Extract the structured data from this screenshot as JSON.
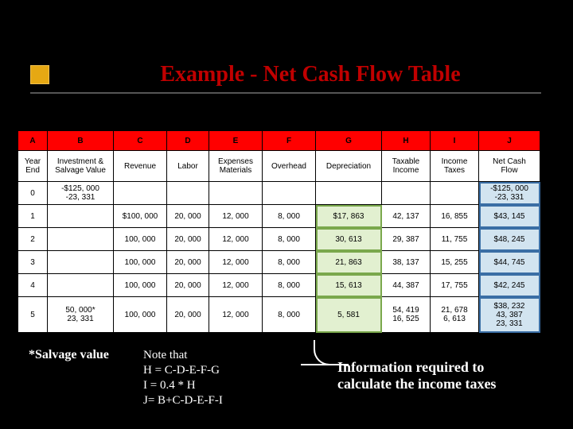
{
  "title": "Example - Net Cash Flow Table",
  "cols": {
    "A": "A",
    "B": "B",
    "C": "C",
    "D": "D",
    "E": "E",
    "F": "F",
    "G": "G",
    "H": "H",
    "I": "I",
    "J": "J"
  },
  "hdr": {
    "A": "Year\nEnd",
    "B": "Investment &\nSalvage Value",
    "C": "Revenue",
    "D": "Labor",
    "E": "Expenses\nMaterials",
    "F": "Overhead",
    "G": "Depreciation",
    "H": "Taxable\nIncome",
    "I": "Income\nTaxes",
    "J": "Net Cash\nFlow"
  },
  "rows": [
    {
      "A": "0",
      "B": "-$125, 000\n-23, 331",
      "C": "",
      "D": "",
      "E": "",
      "F": "",
      "G": "",
      "H": "",
      "I": "",
      "J": "-$125, 000\n-23, 331"
    },
    {
      "A": "1",
      "B": "",
      "C": "$100, 000",
      "D": "20, 000",
      "E": "12, 000",
      "F": "8, 000",
      "G": "$17, 863",
      "H": "42, 137",
      "I": "16, 855",
      "J": "$43, 145"
    },
    {
      "A": "2",
      "B": "",
      "C": "100, 000",
      "D": "20, 000",
      "E": "12, 000",
      "F": "8, 000",
      "G": "30, 613",
      "H": "29, 387",
      "I": "11, 755",
      "J": "$48, 245"
    },
    {
      "A": "3",
      "B": "",
      "C": "100, 000",
      "D": "20, 000",
      "E": "12, 000",
      "F": "8, 000",
      "G": "21, 863",
      "H": "38, 137",
      "I": "15, 255",
      "J": "$44, 745"
    },
    {
      "A": "4",
      "B": "",
      "C": "100, 000",
      "D": "20, 000",
      "E": "12, 000",
      "F": "8, 000",
      "G": "15, 613",
      "H": "44, 387",
      "I": "17, 755",
      "J": "$42, 245"
    },
    {
      "A": "5",
      "B": "50, 000*\n23, 331",
      "C": "100, 000",
      "D": "20, 000",
      "E": "12, 000",
      "F": "8, 000",
      "G": "5, 581",
      "H": "54, 419\n16, 525",
      "I": "21, 678\n6, 613",
      "J": "$38, 232\n43, 387\n23, 331"
    }
  ],
  "salvage": "*Salvage value",
  "note_lines": {
    "l0": "Note that",
    "l1": "H = C-D-E-F-G",
    "l2": "I = 0.4 * H",
    "l3": "J= B+C-D-E-F-I"
  },
  "info_lines": {
    "l0": "Information required to",
    "l1": "calculate the income taxes"
  },
  "chart_data": {
    "type": "table",
    "title": "Example - Net Cash Flow Table",
    "columns": [
      "Year End",
      "Investment & Salvage Value",
      "Revenue",
      "Labor",
      "Expenses Materials",
      "Overhead",
      "Depreciation",
      "Taxable Income",
      "Income Taxes",
      "Net Cash Flow"
    ],
    "data": [
      [
        0,
        "-$125,000 / -23,331",
        null,
        null,
        null,
        null,
        null,
        null,
        null,
        "-$125,000 / -23,331"
      ],
      [
        1,
        null,
        100000,
        20000,
        12000,
        8000,
        17863,
        42137,
        16855,
        43145
      ],
      [
        2,
        null,
        100000,
        20000,
        12000,
        8000,
        30613,
        29387,
        11755,
        48245
      ],
      [
        3,
        null,
        100000,
        20000,
        12000,
        8000,
        21863,
        38137,
        15255,
        44745
      ],
      [
        4,
        null,
        100000,
        20000,
        12000,
        8000,
        15613,
        44387,
        17755,
        42245
      ],
      [
        5,
        "50,000* / 23,331",
        100000,
        20000,
        12000,
        8000,
        5581,
        "54,419 / 16,525",
        "21,678 / 6,613",
        "38,232 / 43,387 / 23,331"
      ]
    ],
    "formulas": [
      "H = C-D-E-F-G",
      "I = 0.4 * H",
      "J = B+C-D-E-F-I"
    ],
    "footnote": "*Salvage value"
  }
}
